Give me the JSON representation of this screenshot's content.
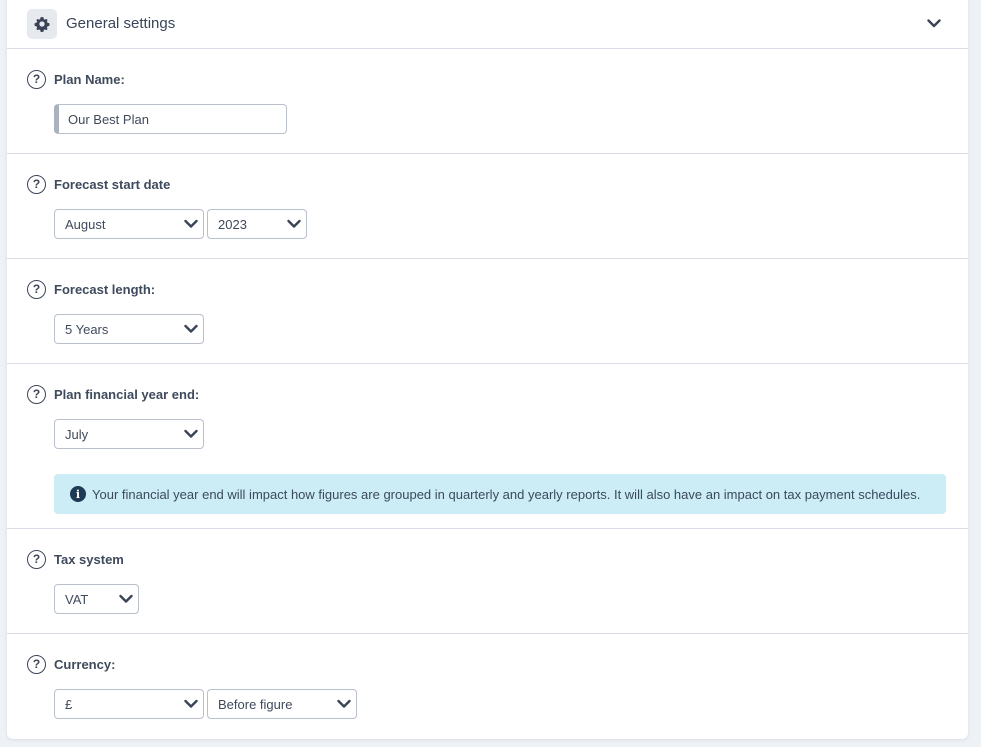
{
  "header": {
    "title": "General settings",
    "icon": "gear-icon",
    "toggle_icon": "chevron-down-icon"
  },
  "sections": {
    "plan_name": {
      "label": "Plan Name:",
      "value": "Our Best Plan"
    },
    "forecast_start": {
      "label": "Forecast start date",
      "month": "August",
      "year": "2023"
    },
    "forecast_length": {
      "label": "Forecast length:",
      "value": "5 Years"
    },
    "financial_year_end": {
      "label": "Plan financial year end:",
      "value": "July",
      "info": "Your financial year end will impact how figures are grouped in quarterly and yearly reports. It will also have an impact on tax payment schedules."
    },
    "tax_system": {
      "label": "Tax system",
      "value": "VAT"
    },
    "currency": {
      "label": "Currency:",
      "symbol": "£",
      "position": "Before figure"
    }
  },
  "glyphs": {
    "help": "?",
    "info": "i"
  },
  "colors": {
    "info_bg": "#cdedf6",
    "info_icon": "#1e3a55",
    "text": "#3f4a5c",
    "border": "#b9c0cb"
  }
}
